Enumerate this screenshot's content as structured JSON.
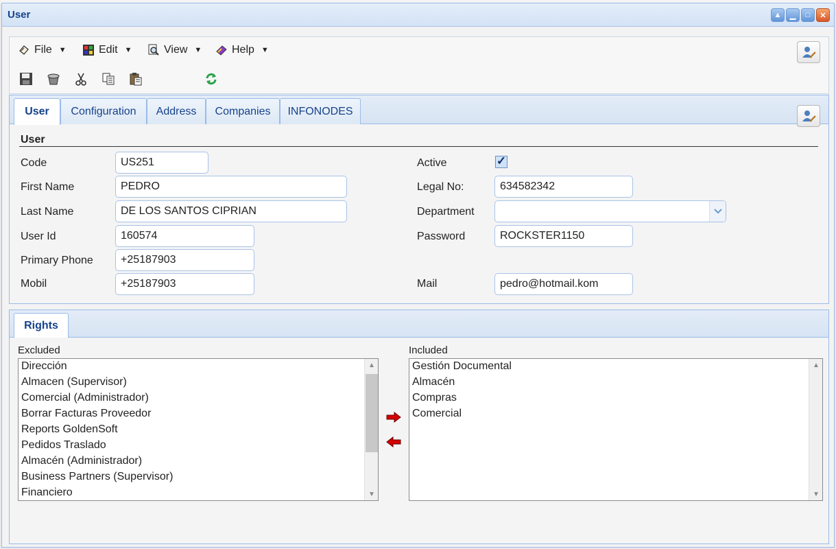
{
  "window": {
    "title": "User",
    "controls": [
      "restore-icon",
      "minimize-icon",
      "maximize-icon",
      "close-icon"
    ]
  },
  "menubar": {
    "items": [
      {
        "label": "File",
        "icon": "file-icon"
      },
      {
        "label": "Edit",
        "icon": "edit-icon"
      },
      {
        "label": "View",
        "icon": "view-icon"
      },
      {
        "label": "Help",
        "icon": "help-icon"
      }
    ],
    "edit_user_icon": "user-edit-icon"
  },
  "toolbar": {
    "icons": [
      "save-icon",
      "delete-icon",
      "cut-icon",
      "copy-icon",
      "paste-icon",
      "refresh-icon"
    ]
  },
  "tabs": [
    {
      "label": "User",
      "active": true
    },
    {
      "label": "Configuration"
    },
    {
      "label": "Address"
    },
    {
      "label": "Companies"
    },
    {
      "label": "INFONODES"
    }
  ],
  "user_section": {
    "title": "User",
    "code_label": "Code",
    "code": "US251",
    "first_name_label": "First Name",
    "first_name": "PEDRO",
    "last_name_label": "Last Name",
    "last_name": "DE LOS SANTOS CIPRIAN",
    "user_id_label": "User Id",
    "user_id": "160574",
    "primary_phone_label": "Primary Phone",
    "primary_phone": "+25187903",
    "mobil_label": "Mobil",
    "mobil": "+25187903",
    "active_label": "Active",
    "active": true,
    "legal_no_label": "Legal No:",
    "legal_no": "634582342",
    "department_label": "Department",
    "department": "",
    "password_label": "Password",
    "password": "ROCKSTER1150",
    "mail_label": "Mail",
    "mail": "pedro@hotmail.kom"
  },
  "rights": {
    "tab_label": "Rights",
    "excluded_label": "Excluded",
    "excluded": [
      "Dirección",
      "Almacen (Supervisor)",
      "Comercial (Administrador)",
      "Borrar Facturas Proveedor",
      "Reports GoldenSoft",
      "Pedidos Traslado",
      "Almacén (Administrador)",
      "Business Partners (Supervisor)",
      "Financiero"
    ],
    "included_label": "Included",
    "included": [
      "Gestión Documental",
      "Almacén",
      "Compras",
      "Comercial"
    ]
  },
  "colors": {
    "accent": "#15428b",
    "border": "#99bbe8",
    "arrow_red": "#d40000"
  }
}
